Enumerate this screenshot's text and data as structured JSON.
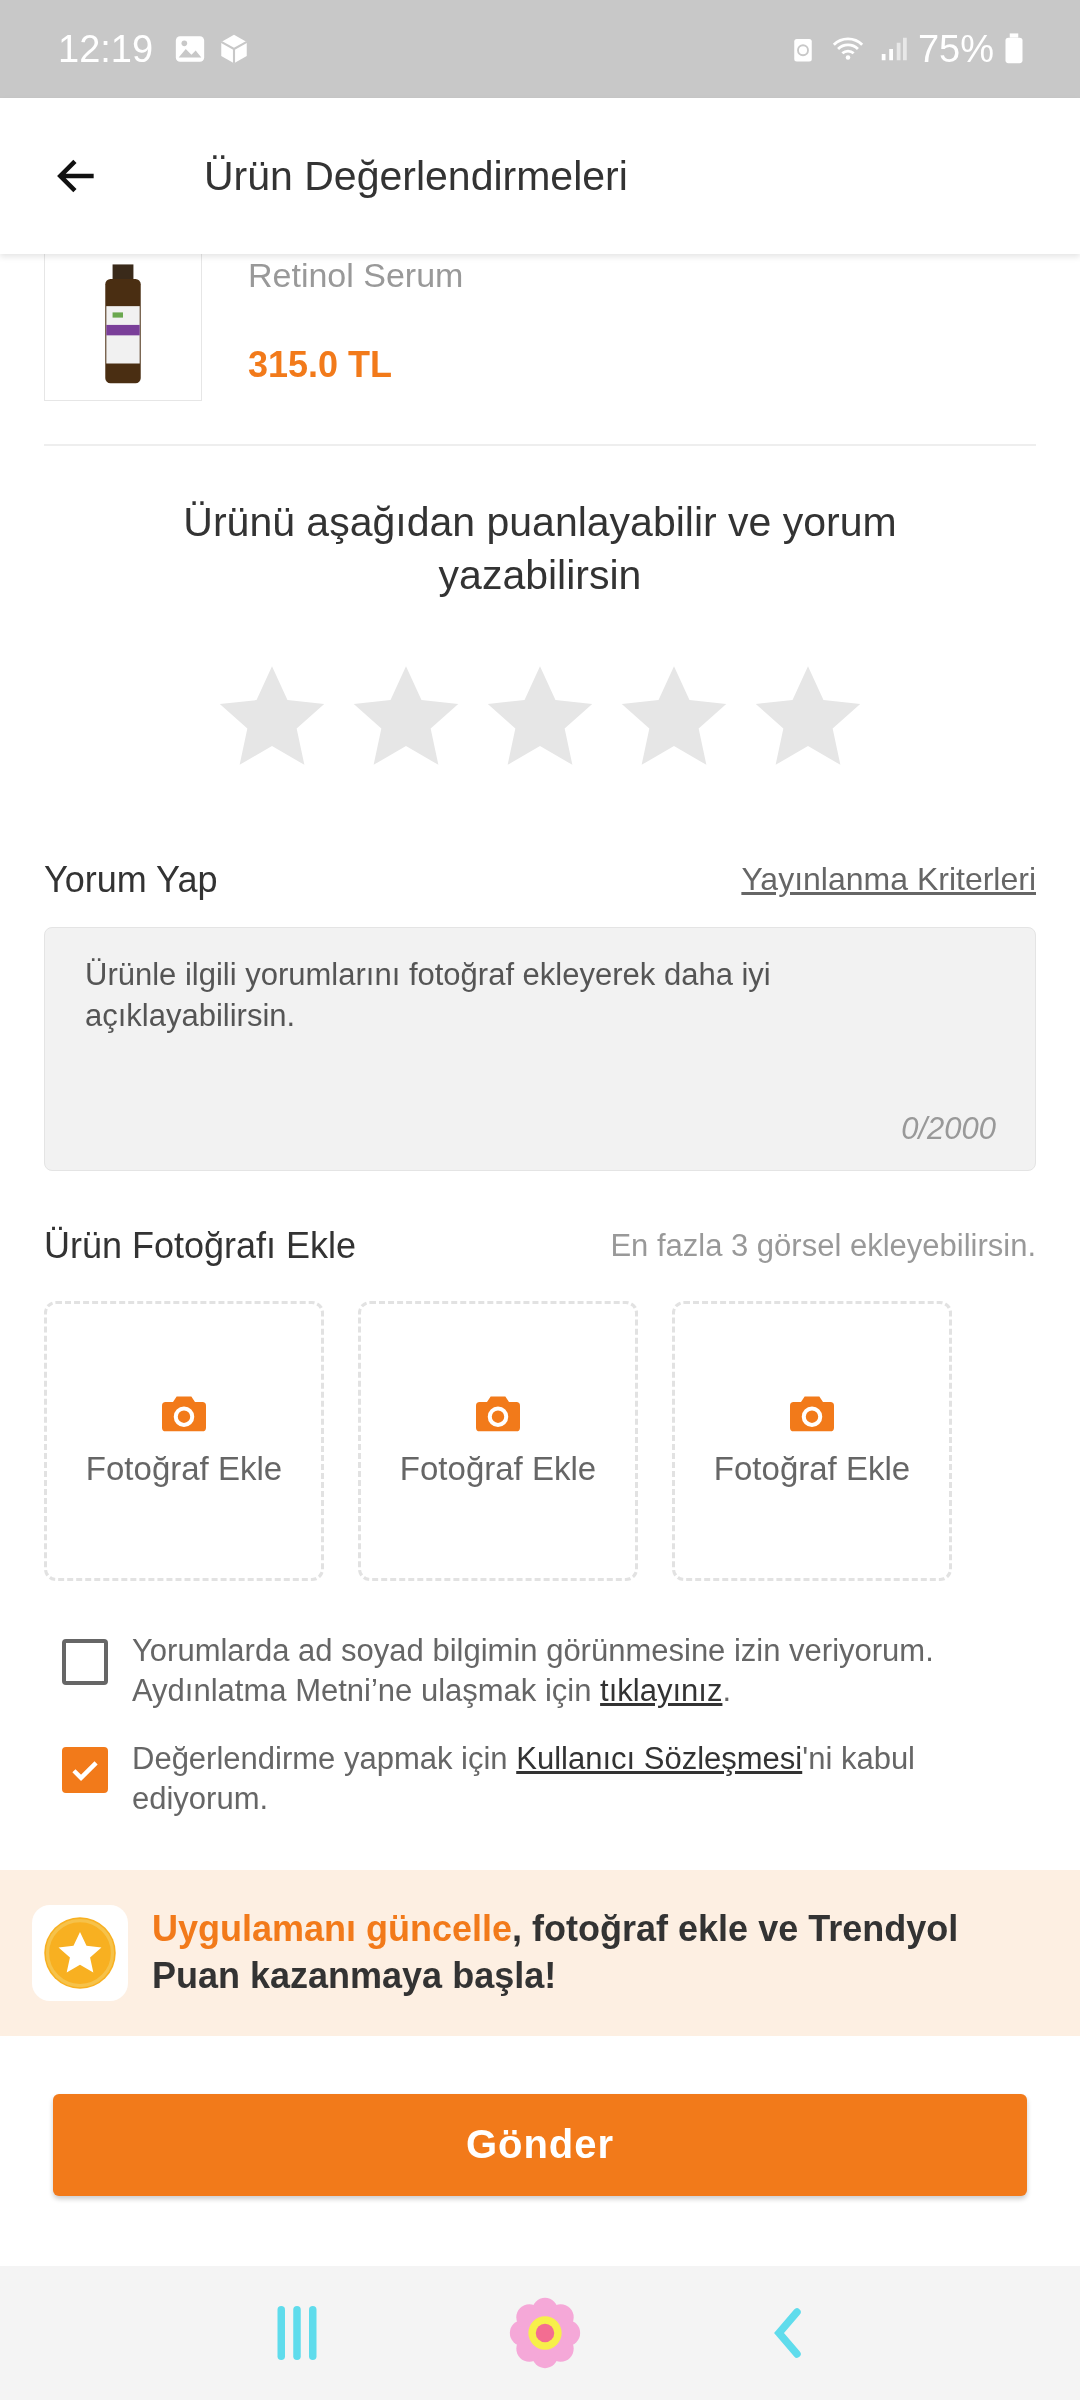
{
  "status_bar": {
    "time": "12:19",
    "battery": "75%"
  },
  "header": {
    "title": "Ürün Değerlendirmeleri"
  },
  "product": {
    "name": "Retinol Serum",
    "price": "315.0 TL"
  },
  "rating": {
    "prompt": "Ürünü aşağıdan puanlayabilir ve yorum yazabilirsin",
    "stars": 0
  },
  "comment": {
    "title": "Yorum Yap",
    "criteria_link": "Yayınlanma Kriterleri",
    "placeholder": "Ürünle ilgili yorumlarını fotoğraf ekleyerek daha iyi açıklayabilirsin.",
    "counter": "0/2000"
  },
  "photos": {
    "title": "Ürün Fotoğrafı Ekle",
    "hint": "En fazla 3 görsel ekleyebilirsin.",
    "slots": [
      {
        "label": "Fotoğraf Ekle"
      },
      {
        "label": "Fotoğraf Ekle"
      },
      {
        "label": "Fotoğraf Ekle"
      }
    ]
  },
  "consents": [
    {
      "checked": false,
      "text_before": "Yorumlarda ad soyad bilgimin görünmesine izin veriyorum. Aydınlatma Metni’ne ulaşmak için ",
      "link": "tıklayınız",
      "text_after": "."
    },
    {
      "checked": true,
      "text_before": "Değerlendirme yapmak için ",
      "link": "Kullanıcı Sözleşmesi",
      "text_after": "'ni kabul ediyorum."
    }
  ],
  "banner": {
    "highlight": "Uygulamanı güncelle",
    "text": ", fotoğraf ekle ve Trendyol Puan kazanmaya başla!"
  },
  "submit_button": "Gönder"
}
